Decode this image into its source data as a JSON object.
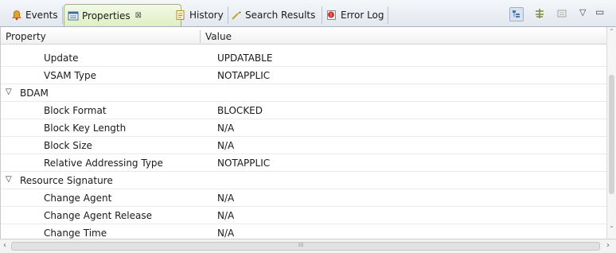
{
  "tabs": [
    {
      "label": "Events",
      "icon": "bell-icon"
    },
    {
      "label": "Properties",
      "icon": "properties-icon",
      "active": true,
      "close": "⊠"
    },
    {
      "label": "History",
      "icon": "history-icon"
    },
    {
      "label": "Search Results",
      "icon": "search-results-icon"
    },
    {
      "label": "Error Log",
      "icon": "error-log-icon"
    }
  ],
  "toolbar": {
    "buttons": [
      "show-categories-icon",
      "show-advanced-icon",
      "restore-default-icon"
    ],
    "menu_glyph": "▽",
    "minimize_glyph": "▭"
  },
  "table": {
    "headers": {
      "property": "Property",
      "value": "Value"
    },
    "rows": [
      {
        "type": "item",
        "property": "Update",
        "value": "UPDATABLE"
      },
      {
        "type": "item",
        "property": "VSAM Type",
        "value": "NOTAPPLIC"
      },
      {
        "type": "group",
        "property": "BDAM",
        "value": "",
        "twisty": "▽"
      },
      {
        "type": "item",
        "property": "Block Format",
        "value": "BLOCKED"
      },
      {
        "type": "item",
        "property": "Block Key Length",
        "value": "N/A"
      },
      {
        "type": "item",
        "property": "Block Size",
        "value": "N/A"
      },
      {
        "type": "item",
        "property": "Relative Addressing Type",
        "value": "NOTAPPLIC"
      },
      {
        "type": "group",
        "property": "Resource Signature",
        "value": "",
        "twisty": "▽"
      },
      {
        "type": "item",
        "property": "Change Agent",
        "value": "N/A"
      },
      {
        "type": "item",
        "property": "Change Agent Release",
        "value": "N/A"
      },
      {
        "type": "item",
        "property": "Change Time",
        "value": "N/A"
      }
    ]
  },
  "scroll": {
    "left_arrow": "‹",
    "right_arrow": "›",
    "grip": "III",
    "up_arrow": "ˆ",
    "down_arrow": "ˇ"
  }
}
